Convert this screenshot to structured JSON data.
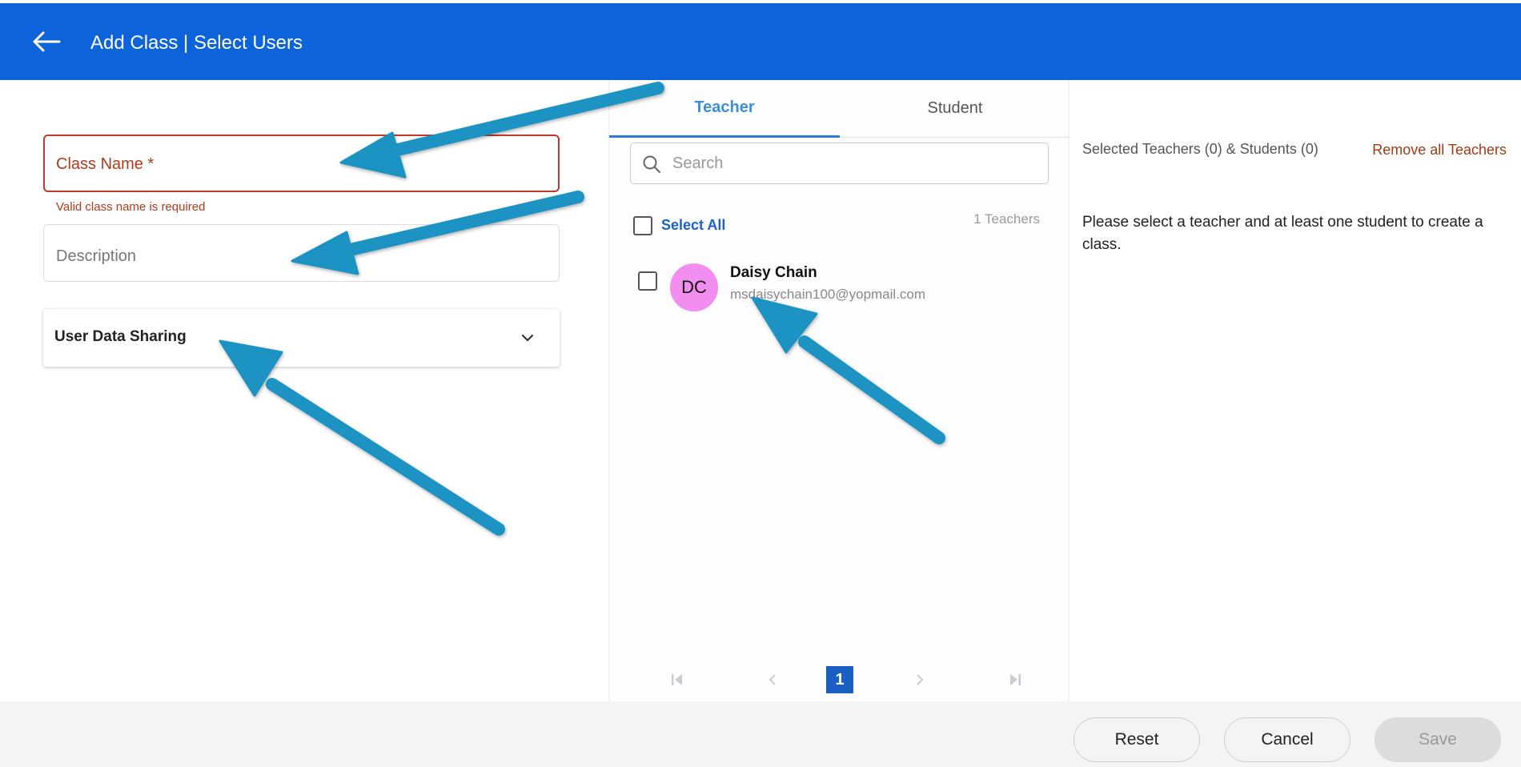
{
  "header": {
    "title": "Add Class | Select Users",
    "background_color": "#0d63d9",
    "back_icon": "arrow-left-icon"
  },
  "form": {
    "class_name_placeholder": "Class Name *",
    "class_name_error": "Valid class name is required",
    "description_placeholder": "Description",
    "user_data_sharing_label": "User Data Sharing"
  },
  "tabs": [
    {
      "label": "Teacher",
      "active": true
    },
    {
      "label": "Student",
      "active": false
    }
  ],
  "search": {
    "placeholder": "Search",
    "value": ""
  },
  "user_list": {
    "select_all_label": "Select All",
    "count_label": "1 Teachers",
    "users": [
      {
        "initials": "DC",
        "name": "Daisy Chain",
        "email": "msdaisychain100@yopmail.com",
        "avatar_color": "#f28ef0"
      }
    ]
  },
  "pagination": {
    "current_page": "1"
  },
  "selection": {
    "summary": "Selected Teachers (0) & Students (0)",
    "remove_all_label": "Remove all Teachers",
    "instruction": "Please select a teacher and at least one student to create a class."
  },
  "footer": {
    "reset_label": "Reset",
    "cancel_label": "Cancel",
    "save_label": "Save"
  },
  "colors": {
    "primary": "#0d63d9",
    "error": "#b33a1a",
    "annotation_arrow": "#1a93c2"
  }
}
